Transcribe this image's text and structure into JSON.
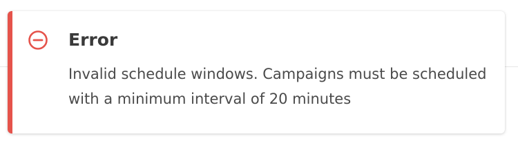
{
  "alert": {
    "variant": "error",
    "icon": "minus-circle-icon",
    "accent_color": "#e5534b",
    "title": "Error",
    "message": "Invalid schedule windows. Campaigns must be scheduled with a minimum interval of 20 minutes"
  }
}
